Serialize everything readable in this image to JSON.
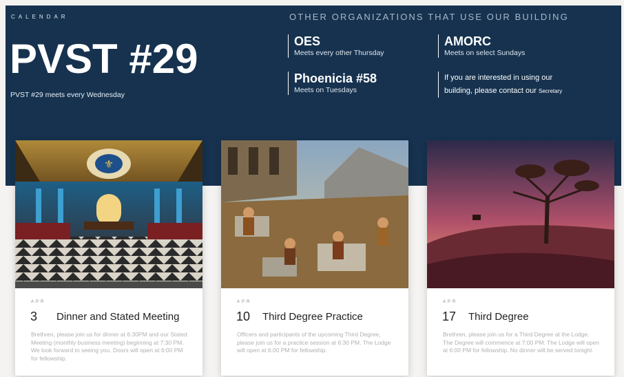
{
  "calendar_label": "CALENDAR",
  "lodge": {
    "title": "PVST #29",
    "subtitle": "PVST #29 meets every Wednesday"
  },
  "orgs": {
    "heading": "OTHER ORGANIZATIONS THAT USE OUR BUILDING",
    "items": [
      {
        "name": "OES",
        "desc": "Meets every other Thursday"
      },
      {
        "name": "AMORC",
        "desc": "Meets on select Sundays"
      },
      {
        "name": "Phoenicia #58",
        "desc": "Meets on Tuesdays"
      }
    ],
    "contact_text": "If you are interested in using our building, please contact our",
    "contact_link": "Secretary"
  },
  "events": [
    {
      "month": "APR",
      "day": "3",
      "title": "Dinner and Stated Meeting",
      "desc": "Brethren, please join us for dinner at 6:30PM and our Stated Meeting (monthly business meeting) beginning at 7:30 PM. We look forward to seeing you. Doors will open at 6:00 PM for fellowship."
    },
    {
      "month": "APR",
      "day": "10",
      "title": "Third Degree Practice",
      "desc": "Officers and participants of the upcoming Third Degree, please join us for a practice session at 6:30 PM. The Lodge will open at 6:00 PM for fellowship."
    },
    {
      "month": "APR",
      "day": "17",
      "title": "Third Degree",
      "desc": "Brethren, please join us for a Third Degree at the Lodge. The Degree will commence at 7:00 PM. The Lodge will open at 6:00 PM for fellowship. No dinner will be served tonight."
    }
  ],
  "colors": {
    "hero_bg": "#16324f",
    "page_bg": "#f4f3f1",
    "card_bg": "#ffffff"
  }
}
